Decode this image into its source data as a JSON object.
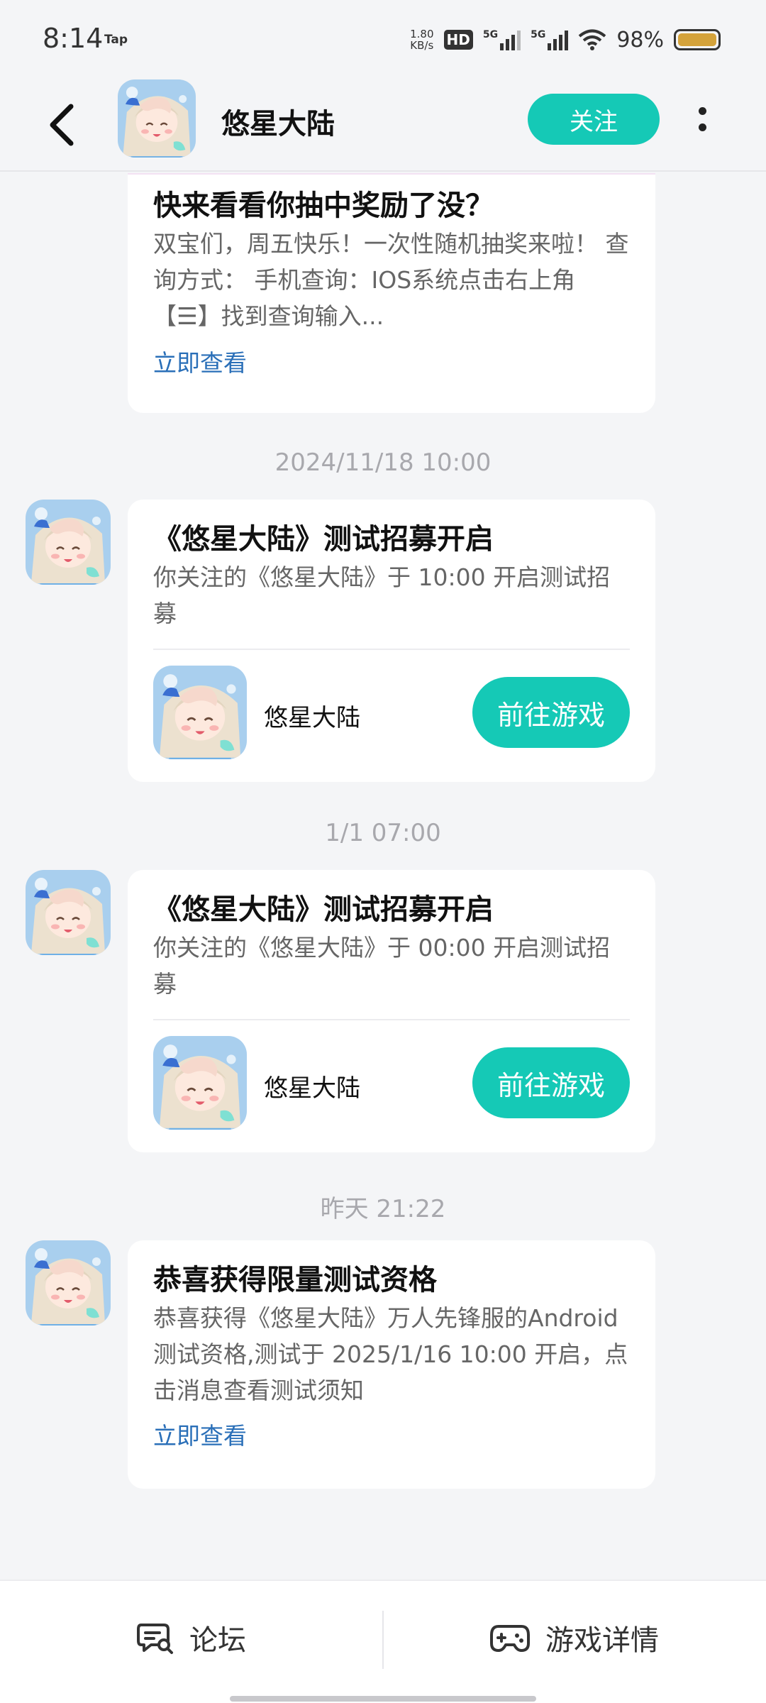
{
  "status_bar": {
    "time": "8:14",
    "app_tag": "Tap",
    "net_speed": "1.80",
    "net_unit": "KB/s",
    "hd": "HD",
    "sim1": "5G",
    "sim2": "5G",
    "battery": "98%",
    "battery_color": "#d4a33b"
  },
  "header": {
    "title": "悠星大陆",
    "follow_label": "关注"
  },
  "colors": {
    "accent": "#15c9b6",
    "link": "#2a6fb8"
  },
  "feed": [
    {
      "type": "partial_card",
      "title": "快来看看你抽中奖励了没？",
      "body": "双宝们，周五快乐！一次性随机抽奖来啦！ 查询方式： 手机查询：IOS系统点击右上角【☰】找到查询输入...",
      "link": "立即查看"
    },
    {
      "timestamp": "2024/11/18  10:00",
      "title": "《悠星大陆》测试招募开启",
      "body": "你关注的《悠星大陆》于 10:00 开启测试招募",
      "game_name": "悠星大陆",
      "button": "前往游戏"
    },
    {
      "timestamp": "1/1  07:00",
      "title": "《悠星大陆》测试招募开启",
      "body": "你关注的《悠星大陆》于 00:00 开启测试招募",
      "game_name": "悠星大陆",
      "button": "前往游戏"
    },
    {
      "timestamp": "昨天  21:22",
      "title": "恭喜获得限量测试资格",
      "body": "恭喜获得《悠星大陆》万人先锋服的Android测试资格,测试于 2025/1/16 10:00 开启，点击消息查看测试须知",
      "link": "立即查看"
    }
  ],
  "bottom_bar": {
    "forum_label": "论坛",
    "details_label": "游戏详情"
  }
}
